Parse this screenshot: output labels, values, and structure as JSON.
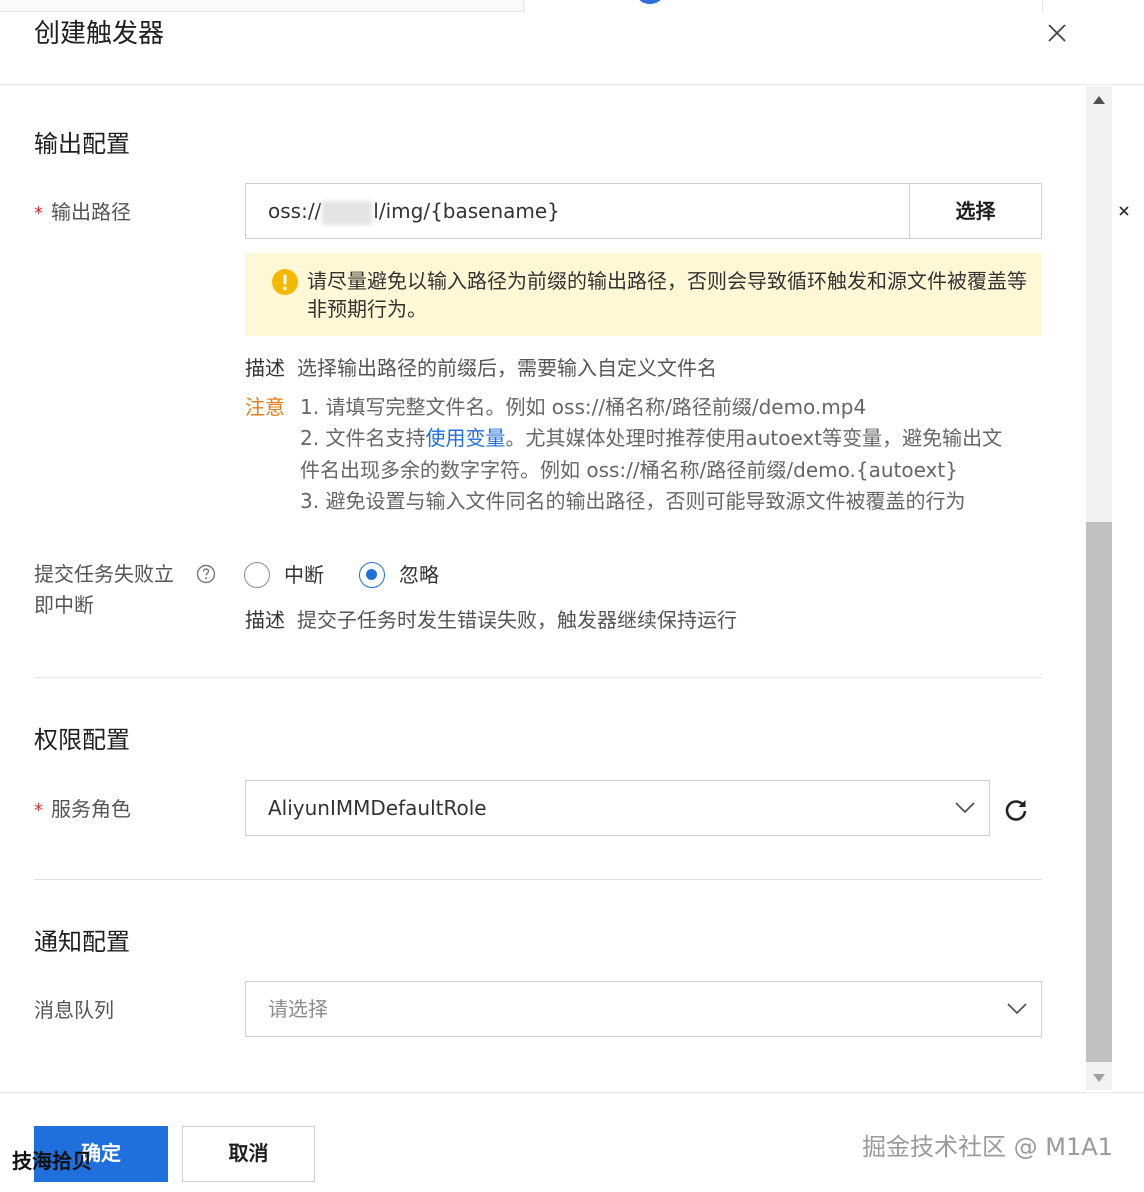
{
  "dialog": {
    "title": "创建触发器"
  },
  "output_section": {
    "title": "输出配置",
    "path_label": "输出路径",
    "path_value_prefix": "oss://",
    "path_value_suffix": "l/img/{basename}",
    "choose_label": "选择",
    "warning": "请尽量避免以输入路径为前缀的输出路径，否则会导致循环触发和源文件被覆盖等非预期行为。",
    "desc_key": "描述",
    "desc_text": "选择输出路径的前缀后，需要输入自定义文件名",
    "note_key": "注意",
    "note_1": "1. 请填写完整文件名。例如 oss://桶名称/路径前缀/demo.mp4",
    "note_2_a": "2. 文件名支持",
    "note_2_link": "使用变量",
    "note_2_b": "。尤其媒体处理时推荐使用autoext等变量，避免输出文",
    "note_2_c": "件名出现多余的数字字符。例如 oss://桶名称/路径前缀/demo.{autoext}",
    "note_3": "3. 避免设置与输入文件同名的输出路径，否则可能导致源文件被覆盖的行为"
  },
  "fail_setting": {
    "label_line1": "提交任务失败立",
    "label_line2": "即中断",
    "options": [
      "中断",
      "忽略"
    ],
    "selected": "忽略",
    "desc_key": "描述",
    "desc_text": "提交子任务时发生错误失败，触发器继续保持运行"
  },
  "permission_section": {
    "title": "权限配置",
    "role_label": "服务角色",
    "role_value": "AliyunIMMDefaultRole"
  },
  "notify_section": {
    "title": "通知配置",
    "queue_label": "消息队列",
    "queue_placeholder": "请选择"
  },
  "footer": {
    "ok_label": "确定",
    "cancel_label": "取消"
  },
  "watermarks": {
    "left": "技海拾贝",
    "right": "掘金技术社区 @ M1A1"
  },
  "colors": {
    "primary": "#1f6fdc",
    "required": "#e0312f",
    "note": "#e07b17",
    "warning_bg": "#fff8d6",
    "warning_icon": "#f5b800"
  }
}
